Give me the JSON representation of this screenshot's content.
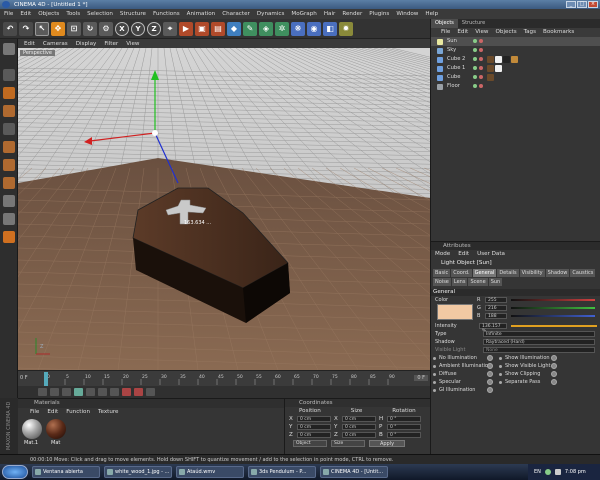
{
  "window": {
    "title": "CINEMA 4D - [Untitled 1 *]"
  },
  "menubar": [
    "File",
    "Edit",
    "Objects",
    "Tools",
    "Selection",
    "Structure",
    "Functions",
    "Animation",
    "Character",
    "Dynamics",
    "MoGraph",
    "Hair",
    "Render",
    "Plugins",
    "Window",
    "Help"
  ],
  "viewport": {
    "menu": [
      "Edit",
      "Cameras",
      "Display",
      "Filter",
      "View"
    ],
    "label": "Perspective",
    "coffin_label": "163.634 ...",
    "axis_label": "Z"
  },
  "timeline": {
    "start_frame": "0 F",
    "end_frame": "0 F",
    "ticks": [
      "0",
      "5",
      "10",
      "15",
      "20",
      "25",
      "30",
      "35",
      "40",
      "45",
      "50",
      "55",
      "60",
      "65",
      "70",
      "75",
      "80",
      "85",
      "90"
    ]
  },
  "materials": {
    "title": "Materials",
    "menu": [
      "File",
      "Edit",
      "Function",
      "Texture"
    ],
    "items": [
      {
        "label": "Mat.1"
      },
      {
        "label": "Mat"
      }
    ]
  },
  "coordinates": {
    "title": "Coordinates",
    "cols": [
      "Position",
      "Size",
      "Rotation"
    ],
    "rows": [
      {
        "axis": "X",
        "pos": "0 cm",
        "size": "0 cm",
        "rot_axis": "H",
        "rot": "0 °"
      },
      {
        "axis": "Y",
        "pos": "0 cm",
        "size": "0 cm",
        "rot_axis": "P",
        "rot": "0 °"
      },
      {
        "axis": "Z",
        "pos": "0 cm",
        "size": "0 cm",
        "rot_axis": "B",
        "rot": "0 °"
      }
    ],
    "mode1": "Object",
    "mode2": "Size",
    "apply": "Apply"
  },
  "status": "00:00:10  Move: Click and drag to move elements. Hold down SHIFT to quantize movement / add to the selection in point mode, CTRL to remove.",
  "maxon": "MAXON CINEMA 4D",
  "objects_panel": {
    "tabs": [
      "Objects",
      "Structure"
    ],
    "menu": [
      "File",
      "Edit",
      "View",
      "Objects",
      "Tags",
      "Bookmarks"
    ],
    "items": [
      {
        "name": "Sun",
        "icon_color": "#e8e8a0",
        "selected": true,
        "tags": []
      },
      {
        "name": "Sky",
        "icon_color": "#7aa6d6",
        "selected": false,
        "tags": []
      },
      {
        "name": "Cube 2",
        "icon_color": "#6fa0e0",
        "selected": false,
        "tags": [
          "#6a4a2a",
          "#f0f0f0",
          "#222222",
          "#c28a3a"
        ]
      },
      {
        "name": "Cube 1",
        "icon_color": "#6fa0e0",
        "selected": false,
        "tags": [
          "#6a4a2a",
          "#f0f0f0"
        ]
      },
      {
        "name": "Cube",
        "icon_color": "#6fa0e0",
        "selected": false,
        "tags": [
          "#6a4a2a"
        ]
      },
      {
        "name": "Floor",
        "icon_color": "#9aa0a6",
        "selected": false,
        "tags": []
      }
    ]
  },
  "attributes": {
    "title": "Attributes",
    "menu": [
      "Mode",
      "Edit",
      "User Data"
    ],
    "object_title": "Light Object [Sun]",
    "tabs": [
      {
        "label": "Basic",
        "active": false
      },
      {
        "label": "Coord.",
        "active": false
      },
      {
        "label": "General",
        "active": true
      },
      {
        "label": "Details",
        "active": false
      },
      {
        "label": "Visibility",
        "active": false
      },
      {
        "label": "Shadow",
        "active": false
      },
      {
        "label": "Caustics",
        "active": false
      },
      {
        "label": "Noise",
        "active": false
      },
      {
        "label": "Lens",
        "active": false
      },
      {
        "label": "Scene",
        "active": false
      },
      {
        "label": "Sun",
        "active": false
      }
    ],
    "section": "General",
    "color_label": "Color",
    "color_swatch": "#f2c9a3",
    "rgb": [
      {
        "ch": "R",
        "val": "255"
      },
      {
        "ch": "G",
        "val": "216"
      },
      {
        "ch": "B",
        "val": "188"
      }
    ],
    "intensity_label": "Intensity",
    "intensity": "136.157 %",
    "type_label": "Type",
    "type": "Infinite",
    "shadow_label": "Shadow",
    "shadow": "Raytraced (Hard)",
    "visible_light_label": "Visible Light",
    "visible_light": "None",
    "checks_left": [
      "No Illumination",
      "Ambient Illumination",
      "Diffuse",
      "Specular",
      "GI Illumination"
    ],
    "checks_right": [
      "Show Illumination",
      "Show Visible Light",
      "Show Clipping",
      "Separate Pass"
    ]
  },
  "taskbar": {
    "tasks": [
      "Ventana abierta",
      "white_wood_1.jpg - ...",
      "Ataúd.wmv",
      "3ds Pendulum - P...",
      "CINEMA 4D - [Untit..."
    ],
    "lang": "EN",
    "time": "7:08 pm"
  }
}
